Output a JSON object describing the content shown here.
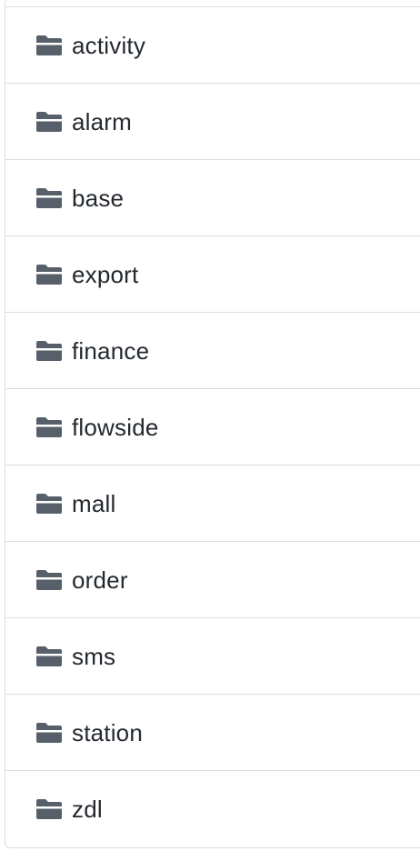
{
  "directory": {
    "items": [
      {
        "name": "activity",
        "icon": "folder-icon"
      },
      {
        "name": "alarm",
        "icon": "folder-icon"
      },
      {
        "name": "base",
        "icon": "folder-icon"
      },
      {
        "name": "export",
        "icon": "folder-icon"
      },
      {
        "name": "finance",
        "icon": "folder-icon"
      },
      {
        "name": "flowside",
        "icon": "folder-icon"
      },
      {
        "name": "mall",
        "icon": "folder-icon"
      },
      {
        "name": "order",
        "icon": "folder-icon"
      },
      {
        "name": "sms",
        "icon": "folder-icon"
      },
      {
        "name": "station",
        "icon": "folder-icon"
      },
      {
        "name": "zdl",
        "icon": "folder-icon"
      }
    ]
  },
  "colors": {
    "folder_icon": "#57606a",
    "text": "#24292f",
    "border": "#d8dee4"
  }
}
